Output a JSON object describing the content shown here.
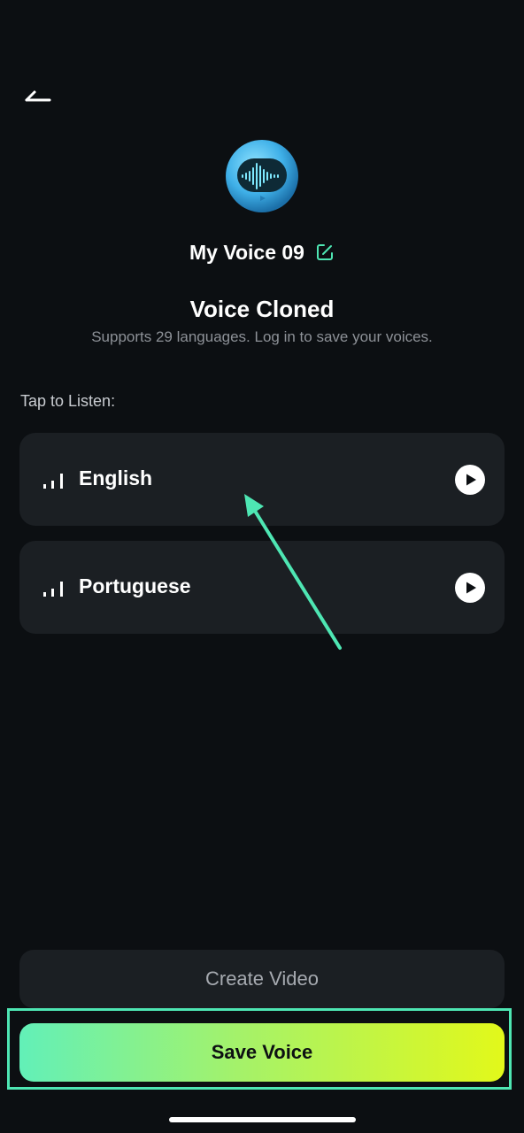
{
  "header": {
    "back_icon": "back-arrow-icon"
  },
  "voice": {
    "name": "My Voice 09",
    "edit_icon": "edit-icon"
  },
  "status": {
    "title": "Voice Cloned",
    "subtitle": "Supports 29 languages. Log in to save your voices."
  },
  "listen": {
    "label": "Tap to Listen:",
    "items": [
      {
        "label": "English",
        "icon": "audio-bars-icon",
        "action_icon": "play-icon"
      },
      {
        "label": "Portuguese",
        "icon": "audio-bars-icon",
        "action_icon": "play-icon"
      }
    ]
  },
  "actions": {
    "create_video_label": "Create Video",
    "save_voice_label": "Save Voice"
  },
  "colors": {
    "background": "#0c0f12",
    "card": "#1b1f23",
    "accent": "#4ee6b3",
    "gradient_start": "#62f0b8",
    "gradient_end": "#e2f81a"
  }
}
